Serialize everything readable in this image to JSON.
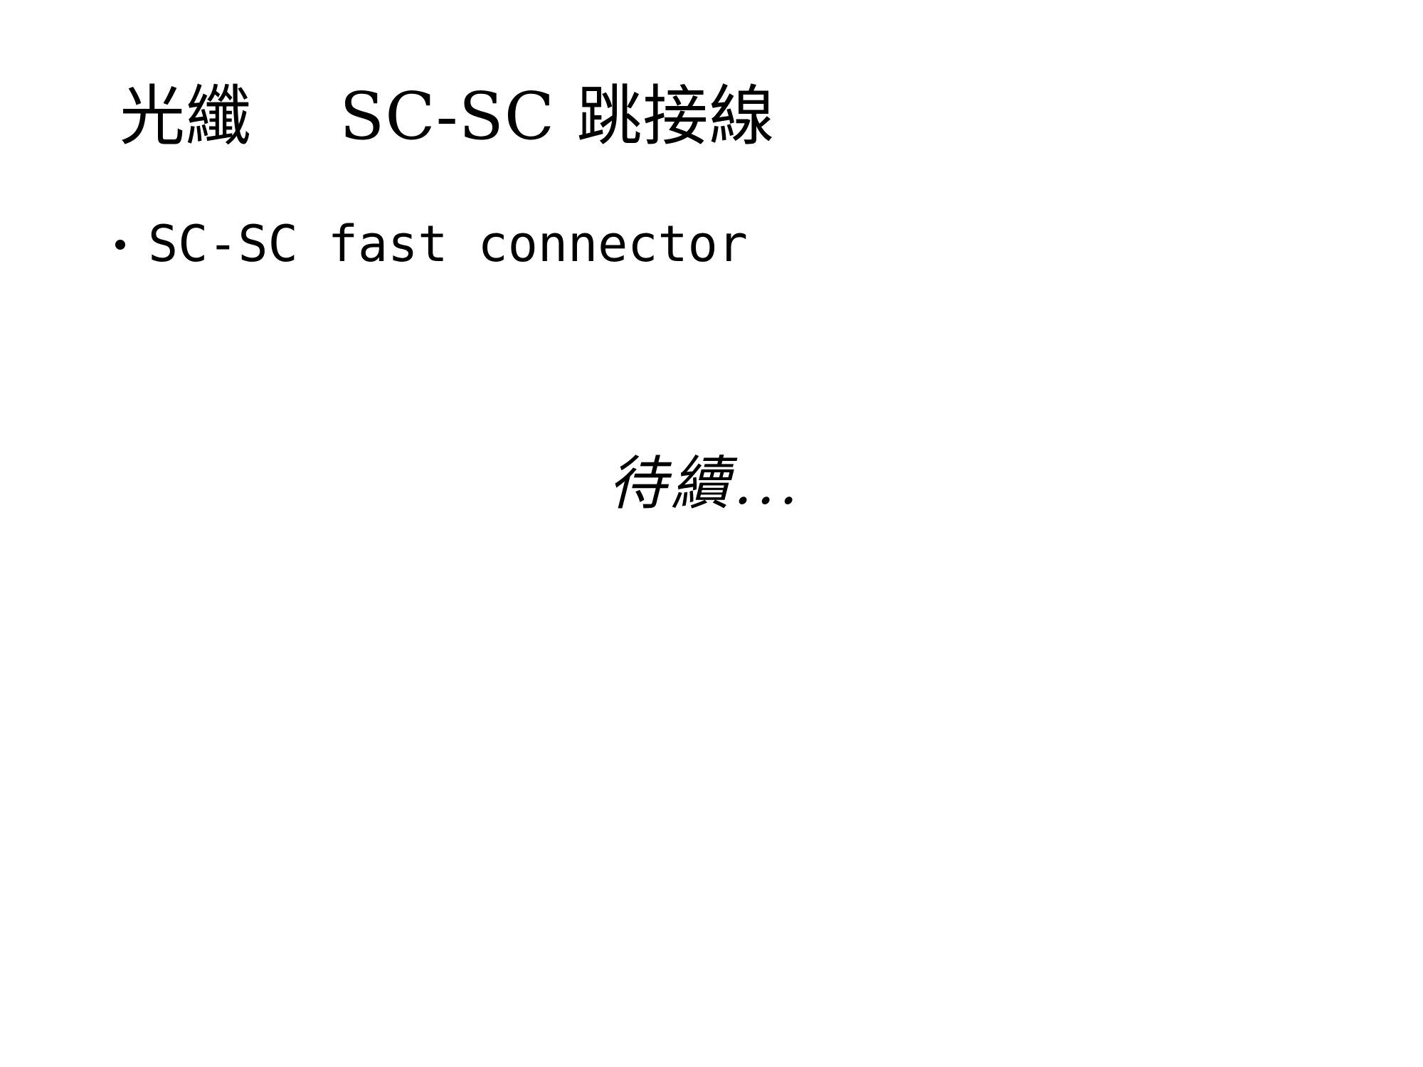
{
  "slide": {
    "title": "光纖　 SC-SC 跳接線",
    "bullets": [
      "SC-SC fast connector"
    ],
    "continued_text": "待續..."
  }
}
